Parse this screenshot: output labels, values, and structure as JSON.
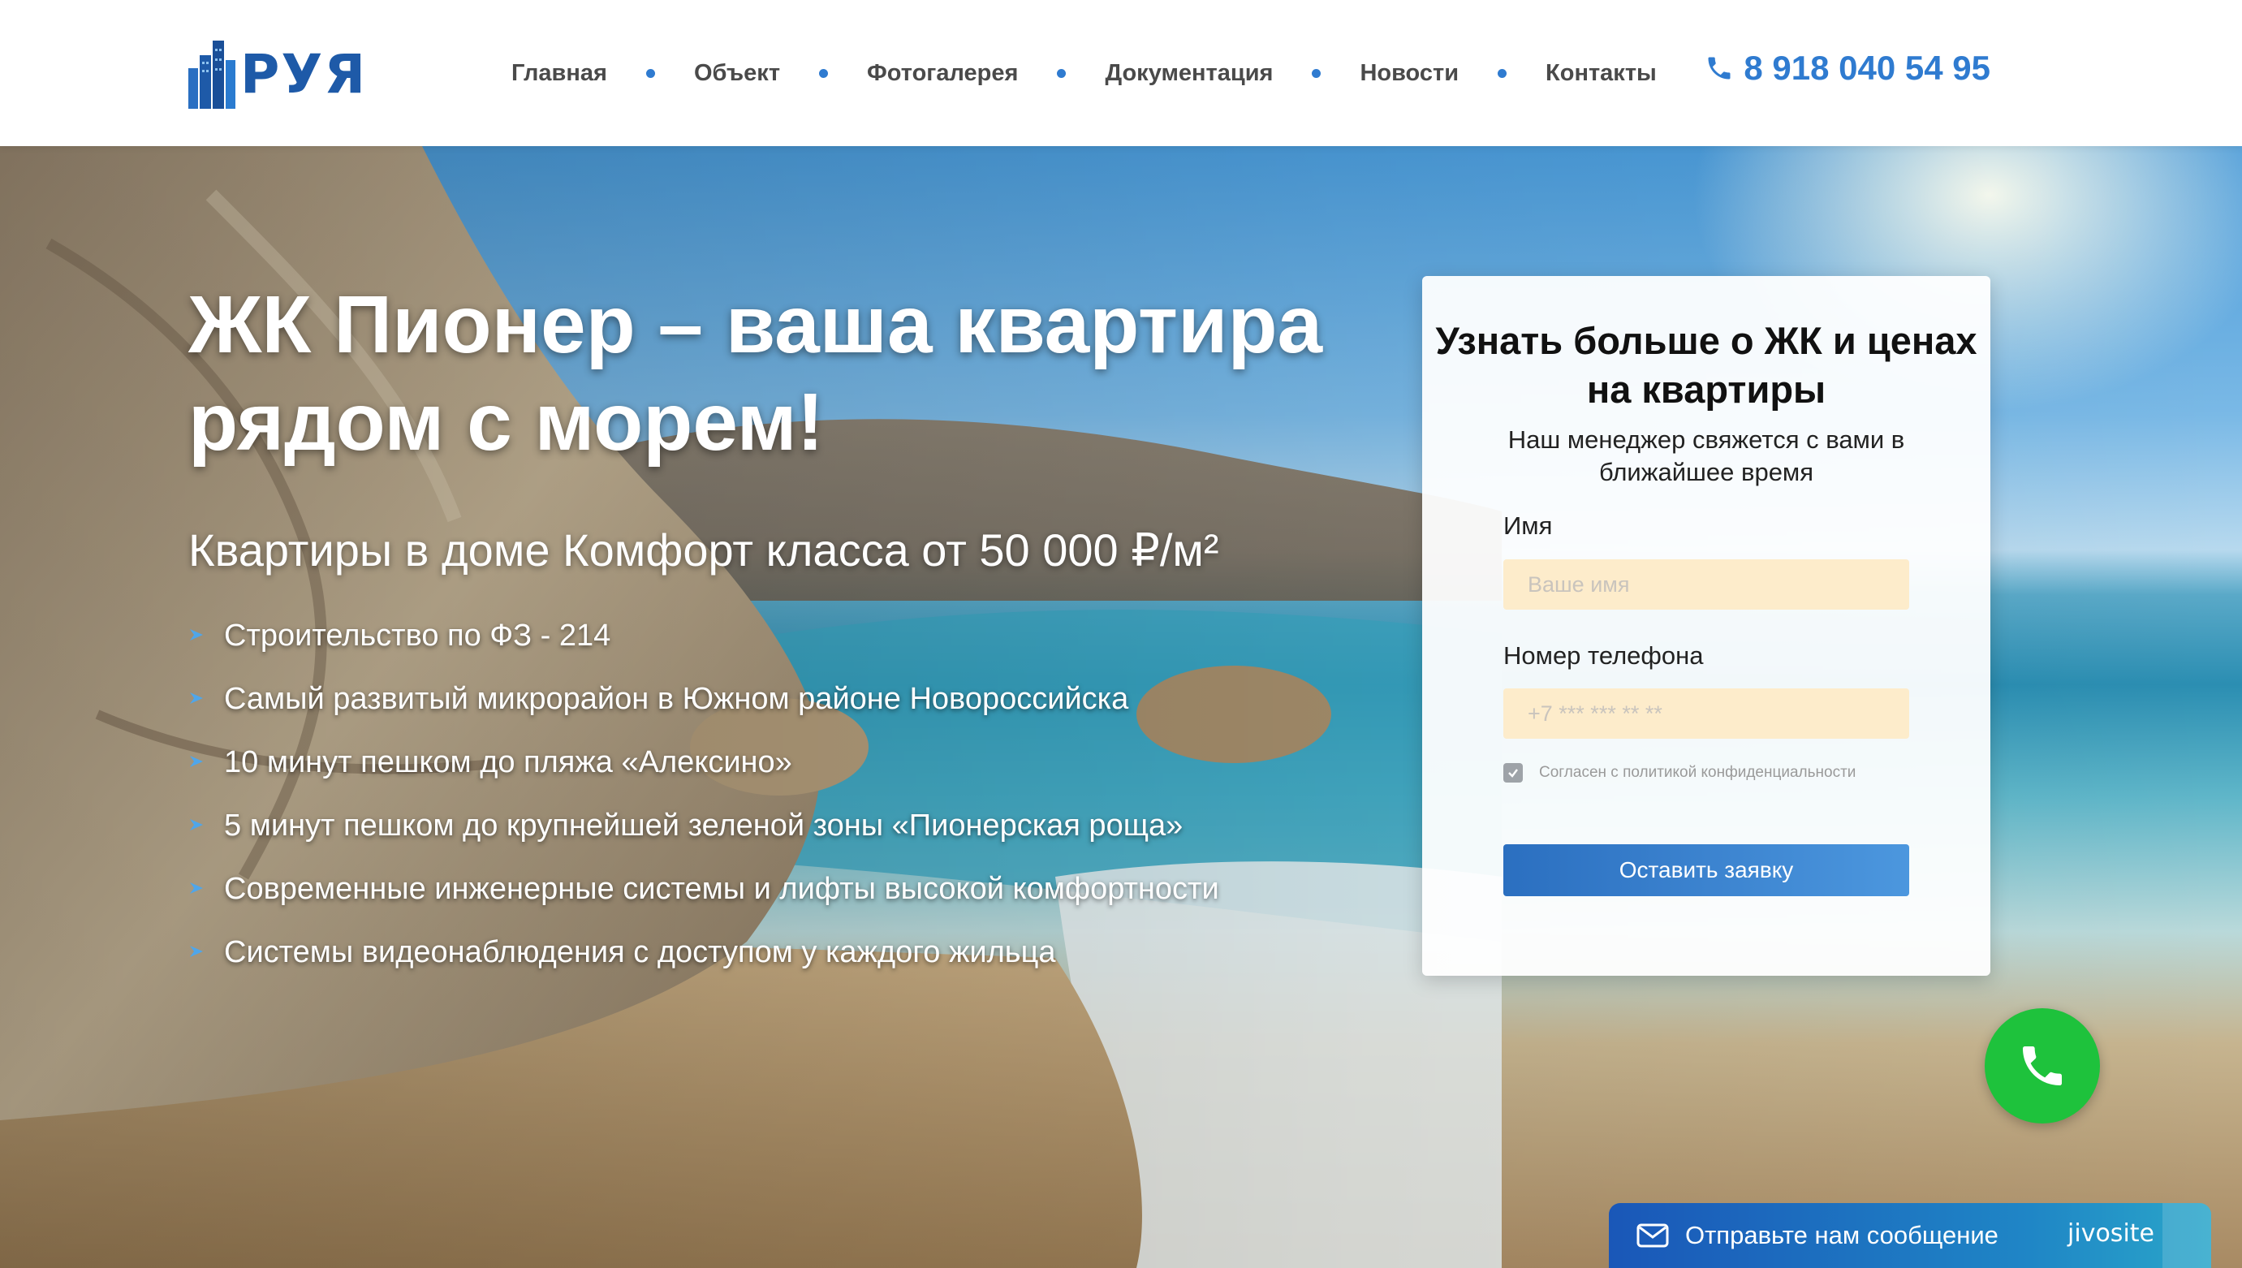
{
  "header": {
    "logo_text": "РУЯ",
    "nav": [
      {
        "label": "Главная"
      },
      {
        "label": "Объект"
      },
      {
        "label": "Фотогалерея"
      },
      {
        "label": "Документация"
      },
      {
        "label": "Новости"
      },
      {
        "label": "Контакты"
      }
    ],
    "phone": "8 918 040 54 95"
  },
  "hero": {
    "title": "ЖК Пионер – ваша квартира рядом с морем!",
    "subtitle": "Квартиры в доме Комфорт класса от 50 000 ₽/м²",
    "features": [
      "Строительство по ФЗ - 214",
      "Самый развитый микрорайон в Южном районе Новороссийска",
      "10 минут пешком до пляжа «Алексино»",
      "5 минут пешком до крупнейшей зеленой зоны «Пионерская роща»",
      "Современные инженерные системы и лифты высокой комфортности",
      "Системы видеонаблюдения с доступом у каждого жильца"
    ]
  },
  "form": {
    "title": "Узнать больше о ЖК и ценах на квартиры",
    "subtitle": "Наш менеджер свяжется с вами в ближайшее время",
    "name_label": "Имя",
    "name_placeholder": "Ваше имя",
    "name_value": "",
    "phone_label": "Номер телефона",
    "phone_placeholder": "+7 *** *** ** **",
    "phone_value": "",
    "consent_text": "Согласен с политикой конфиденциальности",
    "consent_checked": true,
    "submit_label": "Оставить заявку"
  },
  "widgets": {
    "call_icon": "phone-icon",
    "chat_text": "Отправьте нам сообщение",
    "chat_brand": "jivosite"
  },
  "colors": {
    "accent": "#2f7bd0",
    "input_bg": "#fdeccb",
    "call_green": "#1ec23c",
    "chat_blue": "#1a57b8"
  }
}
